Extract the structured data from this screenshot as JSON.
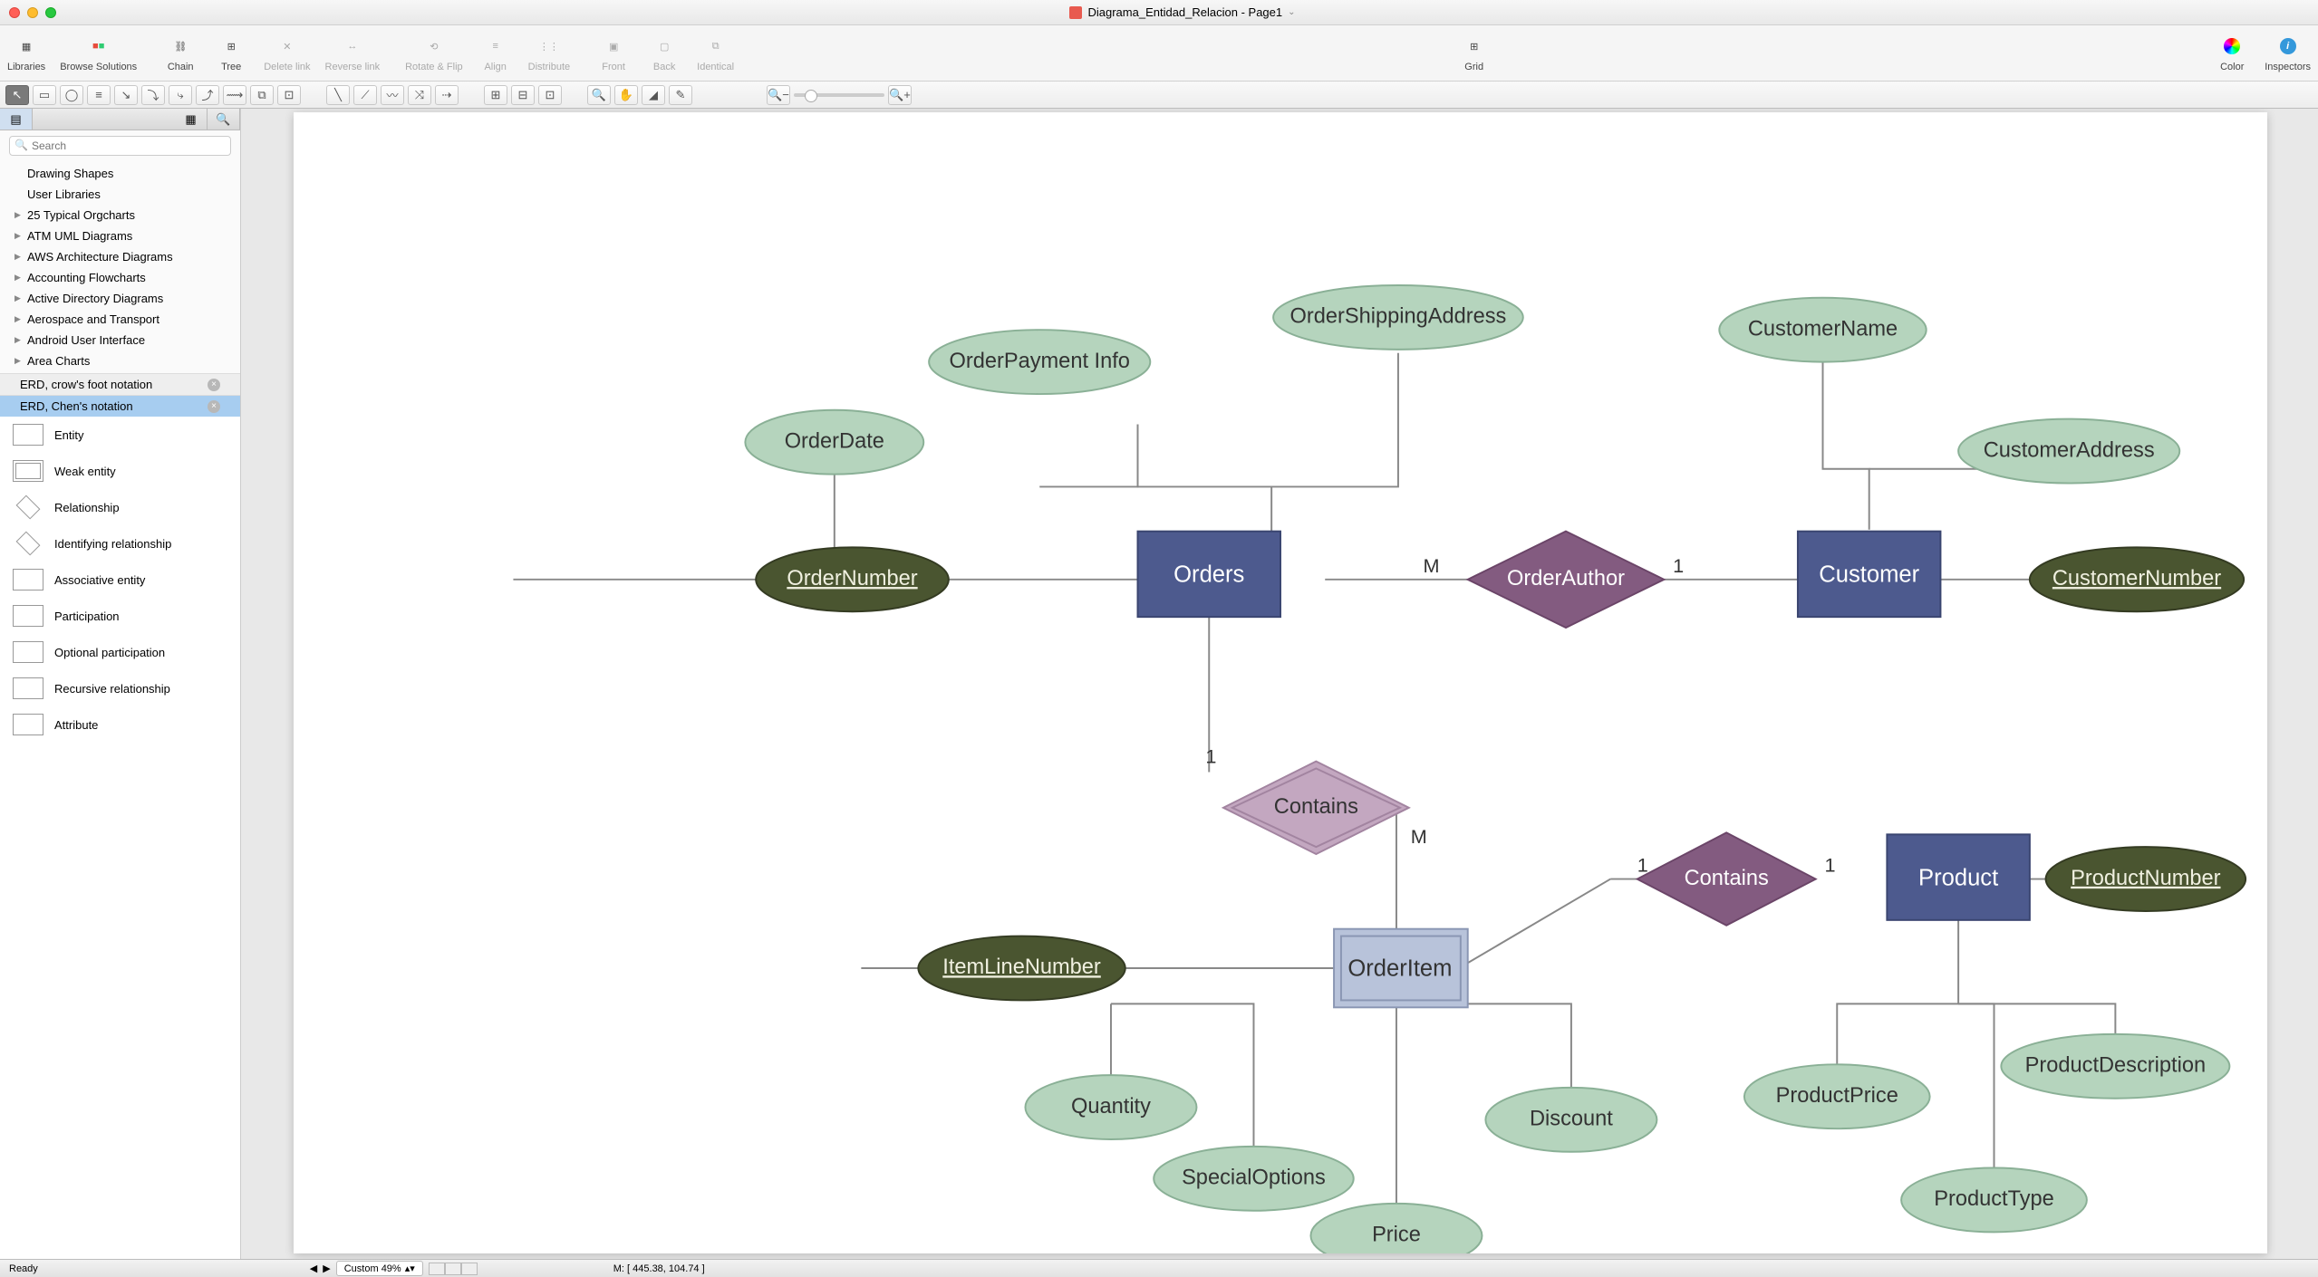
{
  "title": "Diagrama_Entidad_Relacion - Page1",
  "toolbar": {
    "libraries": "Libraries",
    "browse": "Browse Solutions",
    "chain": "Chain",
    "tree": "Tree",
    "delete_link": "Delete link",
    "reverse_link": "Reverse link",
    "rotate_flip": "Rotate & Flip",
    "align": "Align",
    "distribute": "Distribute",
    "front": "Front",
    "back": "Back",
    "identical": "Identical",
    "grid": "Grid",
    "color": "Color",
    "inspectors": "Inspectors"
  },
  "search": {
    "placeholder": "Search"
  },
  "libraries_list": [
    {
      "label": "Drawing Shapes",
      "expandable": false
    },
    {
      "label": "User Libraries",
      "expandable": false
    },
    {
      "label": "25 Typical Orgcharts",
      "expandable": true
    },
    {
      "label": "ATM UML Diagrams",
      "expandable": true
    },
    {
      "label": "AWS Architecture Diagrams",
      "expandable": true
    },
    {
      "label": "Accounting Flowcharts",
      "expandable": true
    },
    {
      "label": "Active Directory Diagrams",
      "expandable": true
    },
    {
      "label": "Aerospace and Transport",
      "expandable": true
    },
    {
      "label": "Android User Interface",
      "expandable": true
    },
    {
      "label": "Area Charts",
      "expandable": true
    }
  ],
  "library_tabs": [
    {
      "label": "ERD, crow's foot notation",
      "selected": false
    },
    {
      "label": "ERD, Chen's notation",
      "selected": true
    }
  ],
  "shapes": [
    {
      "label": "Entity"
    },
    {
      "label": "Weak entity"
    },
    {
      "label": "Relationship"
    },
    {
      "label": "Identifying relationship"
    },
    {
      "label": "Associative entity"
    },
    {
      "label": "Participation"
    },
    {
      "label": "Optional participation"
    },
    {
      "label": "Recursive relationship"
    },
    {
      "label": "Attribute"
    }
  ],
  "status": {
    "ready": "Ready",
    "zoom": "Custom 49%",
    "coords": "M: [ 445.38, 104.74 ]"
  },
  "diagram": {
    "entities": {
      "orders": "Orders",
      "customer": "Customer",
      "order_item": "OrderItem",
      "product": "Product"
    },
    "relationships": {
      "order_author": "OrderAuthor",
      "contains1": "Contains",
      "contains2": "Contains"
    },
    "attributes": {
      "order_date": "OrderDate",
      "order_payment": "OrderPayment Info",
      "order_shipping": "OrderShippingAddress",
      "order_number": "OrderNumber",
      "customer_name": "CustomerName",
      "customer_address": "CustomerAddress",
      "customer_number": "CustomerNumber",
      "item_line_number": "ItemLineNumber",
      "quantity": "Quantity",
      "special_options": "SpecialOptions",
      "price": "Price",
      "discount": "Discount",
      "product_number": "ProductNumber",
      "product_price": "ProductPrice",
      "product_description": "ProductDescription",
      "product_type": "ProductType"
    },
    "cardinalities": {
      "m": "M",
      "one": "1"
    }
  }
}
